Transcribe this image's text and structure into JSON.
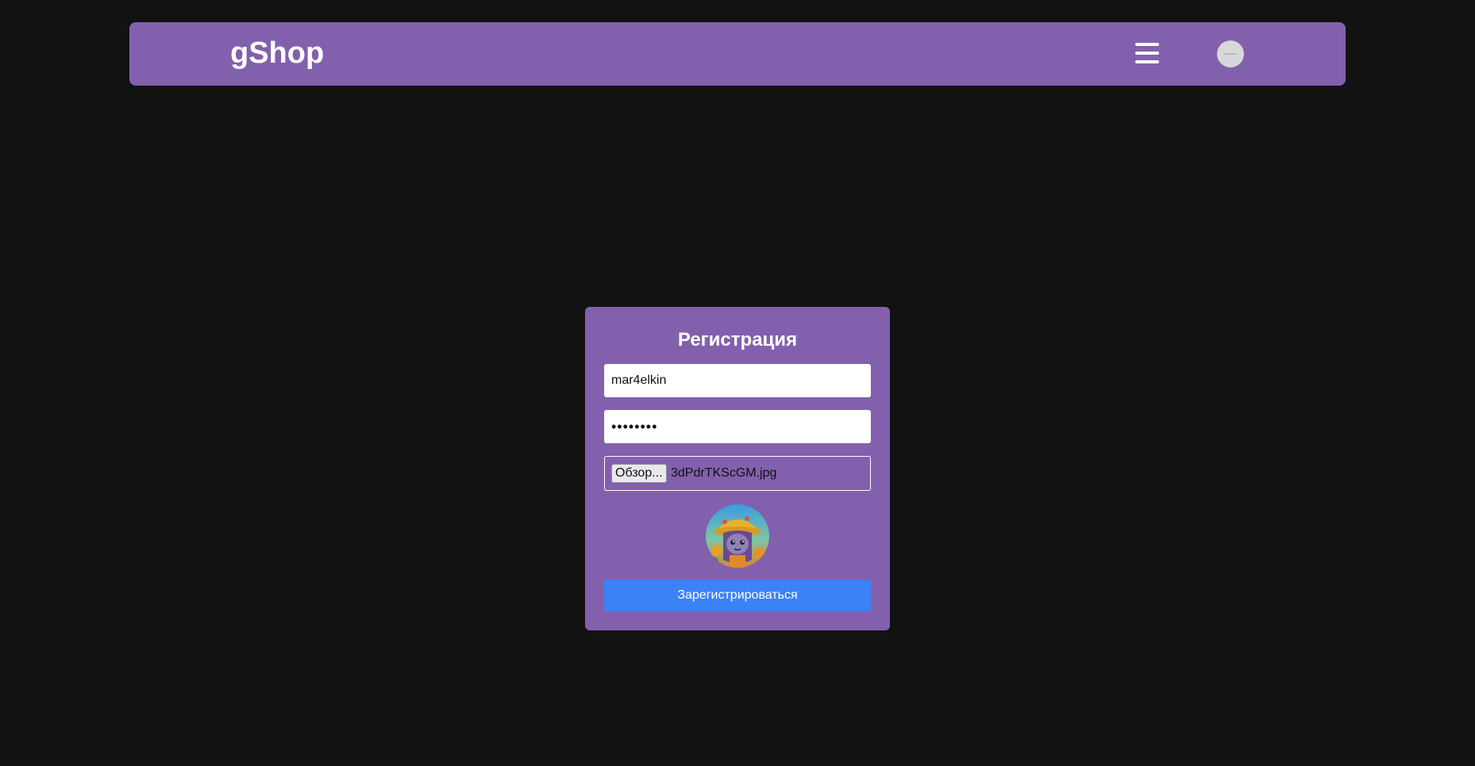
{
  "navbar": {
    "brand": "gShop",
    "menu_icon": "hamburger-menu-icon",
    "avatar_icon": "user-avatar-icon"
  },
  "register_form": {
    "title": "Регистрация",
    "username_value": "mar4elkin",
    "password_value": "••••••••",
    "browse_label": "Обзор...",
    "file_name": "3dPdrTKScGM.jpg",
    "avatar_preview": "avatar-preview-image",
    "submit_label": "Зарегистрироваться"
  },
  "colors": {
    "background": "#121212",
    "navbar": "#8260ad",
    "card": "#8260ad",
    "button": "#3b82f6",
    "text": "#ffffff"
  }
}
